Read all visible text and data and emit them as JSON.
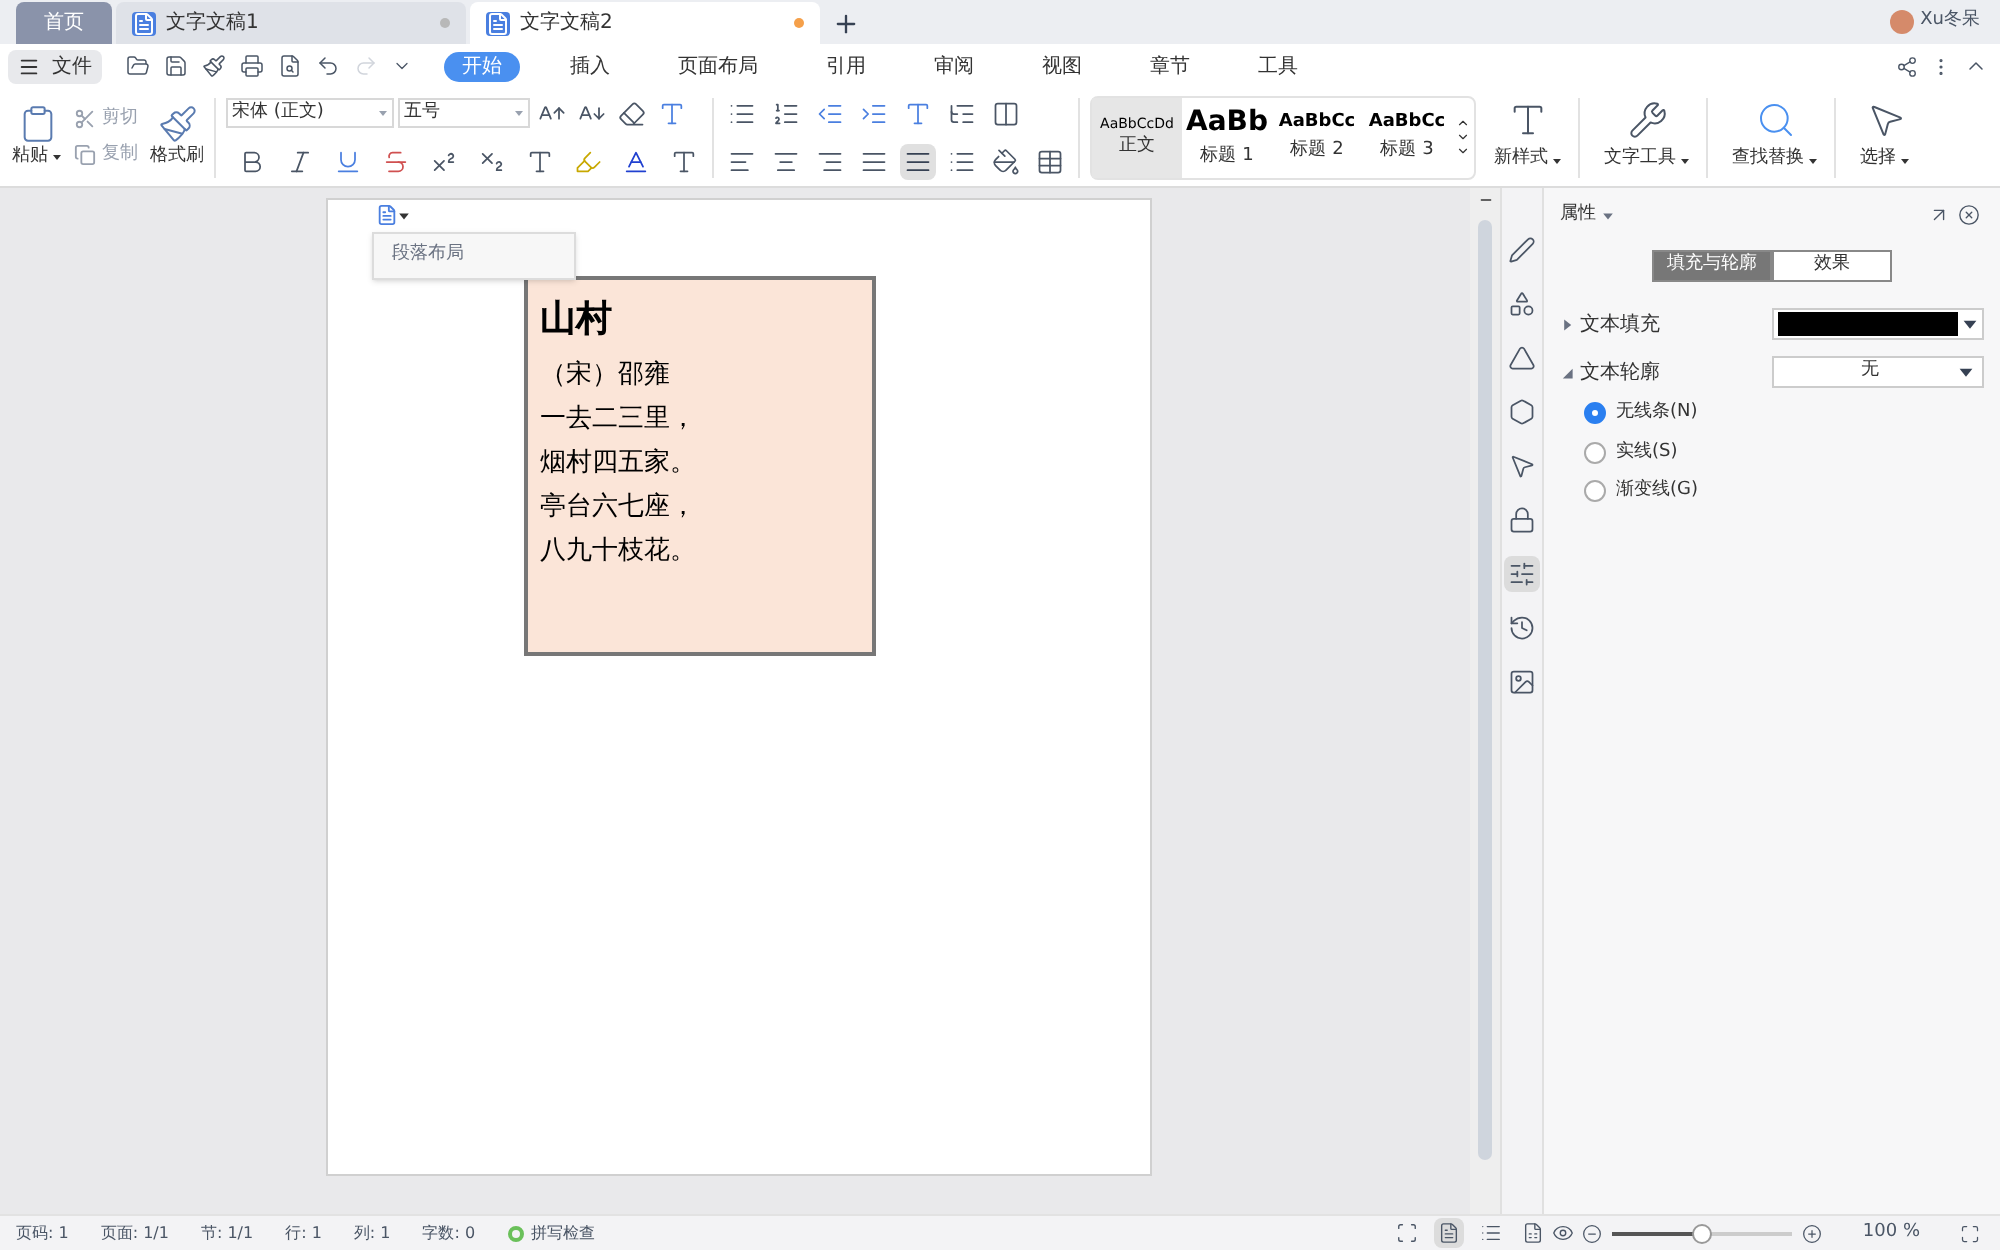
{
  "tabs": [
    {
      "label": "首页",
      "kind": "home",
      "selected": false
    },
    {
      "label": "文字文稿1",
      "kind": "doc",
      "selected": false,
      "modified": false
    },
    {
      "label": "文字文稿2",
      "kind": "doc",
      "selected": true,
      "modified": true
    }
  ],
  "user": "Xu冬呆",
  "file_menu": "文件",
  "ribbon_tabs": [
    {
      "label": "开始",
      "selected": true
    },
    {
      "label": "插入",
      "selected": false
    },
    {
      "label": "页面布局",
      "selected": false
    },
    {
      "label": "引用",
      "selected": false
    },
    {
      "label": "审阅",
      "selected": false
    },
    {
      "label": "视图",
      "selected": false
    },
    {
      "label": "章节",
      "selected": false
    },
    {
      "label": "工具",
      "selected": false
    }
  ],
  "clipboard": {
    "paste": "粘贴",
    "cut": {
      "label": "剪切",
      "disabled": true
    },
    "copy": {
      "label": "复制",
      "disabled": true
    },
    "format_painter": "格式刷"
  },
  "font": {
    "name": "宋体 (正文)",
    "size": "五号"
  },
  "styles": [
    {
      "preview": "AaBbCcDd",
      "label": "正文",
      "kind": "body",
      "selected": true
    },
    {
      "preview": "AaBb",
      "label": "标题 1",
      "kind": "h1",
      "selected": false
    },
    {
      "preview": "AaBbCc",
      "label": "标题 2",
      "kind": "h2",
      "selected": false
    },
    {
      "preview": "AaBbCc",
      "label": "标题 3",
      "kind": "h3",
      "selected": false
    }
  ],
  "tools": [
    "新样式",
    "文字工具",
    "查找替换",
    "选择"
  ],
  "document": {
    "popup": "段落布局",
    "textbox": {
      "title": "山村",
      "lines": [
        "（宋）邵雍",
        "一去二三里，",
        "烟村四五家。",
        "亭台六七座，",
        "八九十枝花。"
      ]
    }
  },
  "properties": {
    "title": "属性",
    "tabs": [
      {
        "label": "填充与轮廓",
        "selected": true
      },
      {
        "label": "效果",
        "selected": false
      }
    ],
    "fill": {
      "label": "文本填充",
      "expanded": false,
      "color": "#000000"
    },
    "outline": {
      "label": "文本轮廓",
      "expanded": true,
      "value": "无",
      "options": [
        {
          "label": "无线条(N)",
          "selected": true
        },
        {
          "label": "实线(S)",
          "selected": false
        },
        {
          "label": "渐变线(G)",
          "selected": false
        }
      ]
    }
  },
  "status_bar": {
    "items": [
      "页码: 1",
      "页面: 1/1",
      "节: 1/1",
      "行: 1",
      "列: 1",
      "字数: 0"
    ],
    "spellcheck": "拼写检查",
    "zoom": {
      "level": 0.5,
      "reading": "100 %"
    }
  }
}
